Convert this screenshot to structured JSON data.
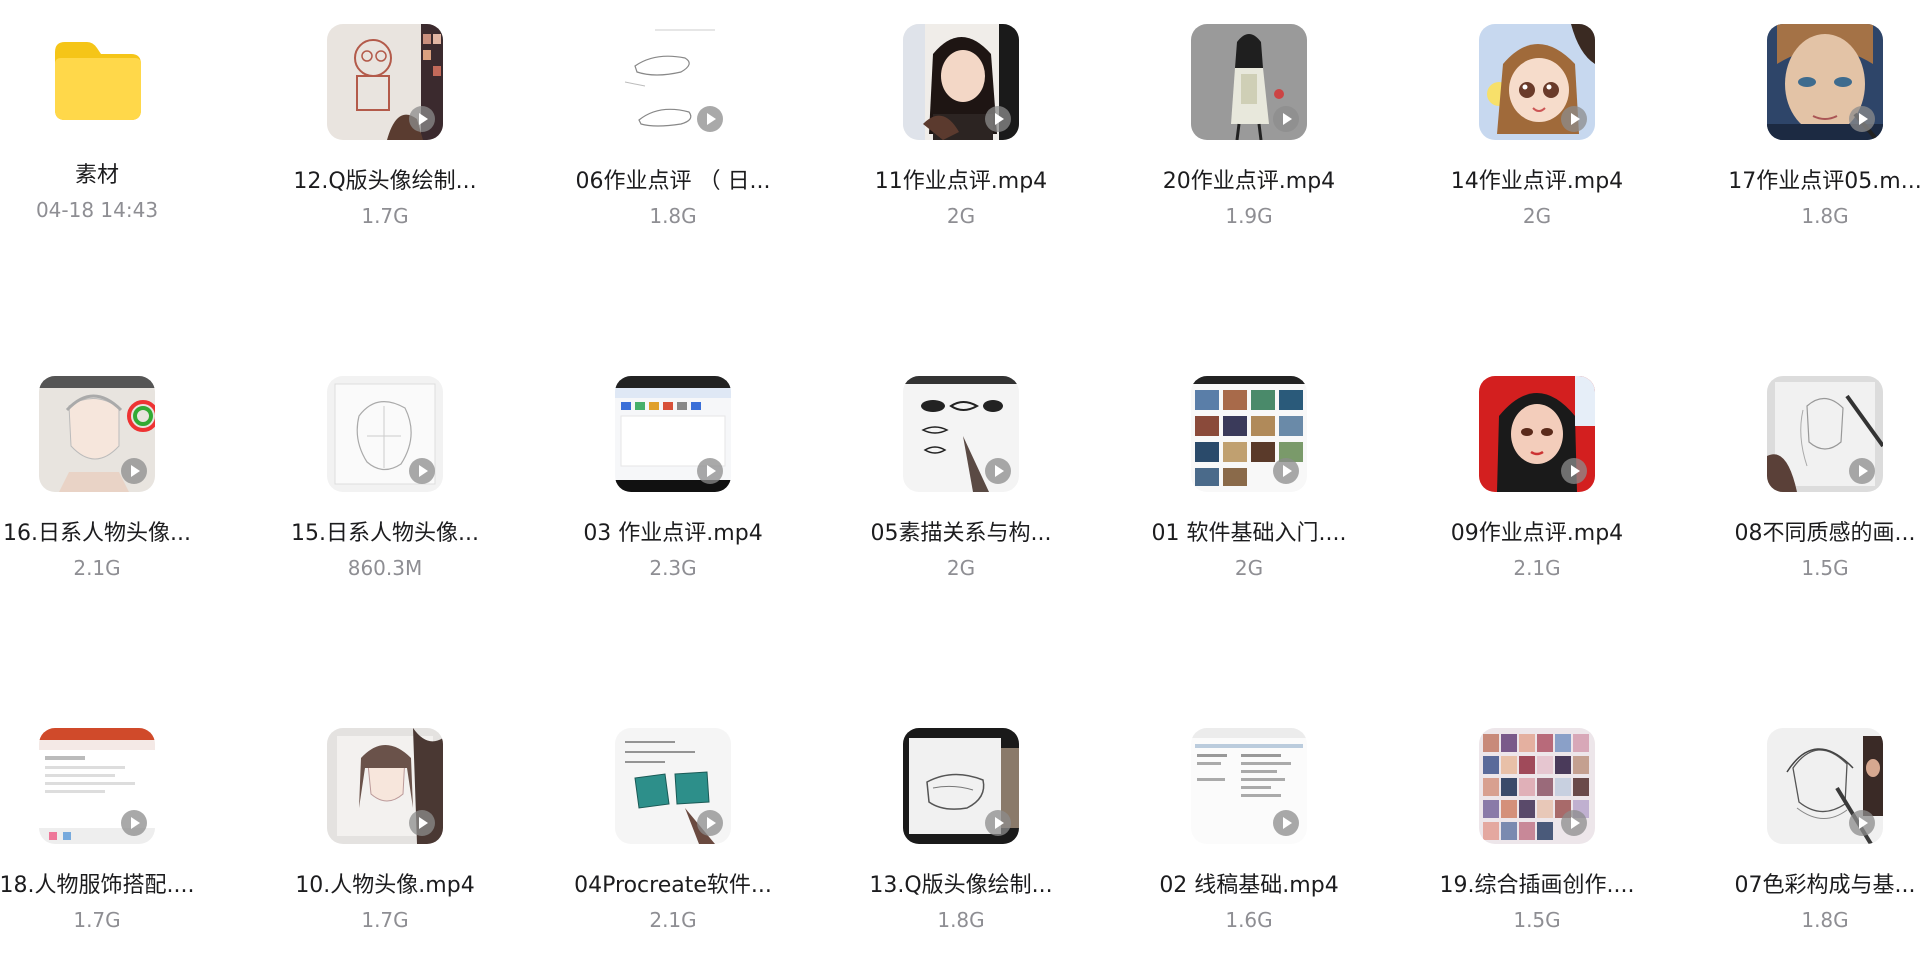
{
  "folder": {
    "name": "素材",
    "date": "04-18 14:43",
    "icon": "folder-icon",
    "color": "#FFD43B"
  },
  "files": [
    {
      "name": "12.Q版头像绘制...",
      "size": "1.7G",
      "thumb": "sketch-character",
      "bg": "#e9e4df",
      "accent": "#b35a4a"
    },
    {
      "name": "06作业点评 （ 日...",
      "size": "1.8G",
      "thumb": "line-sketch",
      "bg": "#ffffff",
      "accent": "#777777"
    },
    {
      "name": "11作业点评.mp4",
      "size": "2G",
      "thumb": "anime-girl",
      "bg": "#f0ede9",
      "accent": "#2a1d1a"
    },
    {
      "name": "20作业点评.mp4",
      "size": "1.9G",
      "thumb": "standing-figure",
      "bg": "#9a9a9a",
      "accent": "#222222"
    },
    {
      "name": "14作业点评.mp4",
      "size": "2G",
      "thumb": "chibi-girl",
      "bg": "#c7d8ef",
      "accent": "#a0673b"
    },
    {
      "name": "17作业点评05.m...",
      "size": "1.8G",
      "thumb": "male-portrait",
      "bg": "#2e4569",
      "accent": "#d8b89a"
    },
    {
      "name": "16.日系人物头像...",
      "size": "2.1G",
      "thumb": "face-sketch-color",
      "bg": "#e8e4df",
      "accent": "#c99"
    },
    {
      "name": "15.日系人物头像...",
      "size": "860.3M",
      "thumb": "face-outline",
      "bg": "#f2f2f2",
      "accent": "#999999"
    },
    {
      "name": "03 作业点评.mp4",
      "size": "2.3G",
      "thumb": "software-ui",
      "bg": "#f6f7f9",
      "accent": "#3a6fd8"
    },
    {
      "name": "05素描关系与构...",
      "size": "2G",
      "thumb": "eye-sketch",
      "bg": "#f4f4f4",
      "accent": "#222222"
    },
    {
      "name": "01 软件基础入门....",
      "size": "2G",
      "thumb": "image-grid",
      "bg": "#f8f8f8",
      "accent": "#5a7ea8"
    },
    {
      "name": "09作业点评.mp4",
      "size": "2.1G",
      "thumb": "red-portrait",
      "bg": "#d31f1f",
      "accent": "#1a1a1a"
    },
    {
      "name": "08不同质感的画...",
      "size": "1.5G",
      "thumb": "tablet-sketch",
      "bg": "#dcdcdc",
      "accent": "#5a4038"
    },
    {
      "name": "18.人物服饰搭配....",
      "size": "1.7G",
      "thumb": "office-doc",
      "bg": "#ffffff",
      "accent": "#d04a2a"
    },
    {
      "name": "10.人物头像.mp4",
      "size": "1.7G",
      "thumb": "tablet-face",
      "bg": "#e4e2e0",
      "accent": "#4a3833"
    },
    {
      "name": "04Procreate软件...",
      "size": "2.1G",
      "thumb": "teal-boxes",
      "bg": "#f5f5f5",
      "accent": "#2d8f8a"
    },
    {
      "name": "13.Q版头像绘制...",
      "size": "1.8G",
      "thumb": "tablet-lines",
      "bg": "#e8e8e8",
      "accent": "#333333"
    },
    {
      "name": "02 线稿基础.mp4",
      "size": "1.6G",
      "thumb": "document-page",
      "bg": "#fbfbfb",
      "accent": "#666666"
    },
    {
      "name": "19.综合插画创作....",
      "size": "1.5G",
      "thumb": "portrait-grid",
      "bg": "#ede6ea",
      "accent": "#b86a7a"
    },
    {
      "name": "07色彩构成与基...",
      "size": "1.8G",
      "thumb": "pencil-portrait",
      "bg": "#f0f0f0",
      "accent": "#3a3a3a"
    }
  ]
}
